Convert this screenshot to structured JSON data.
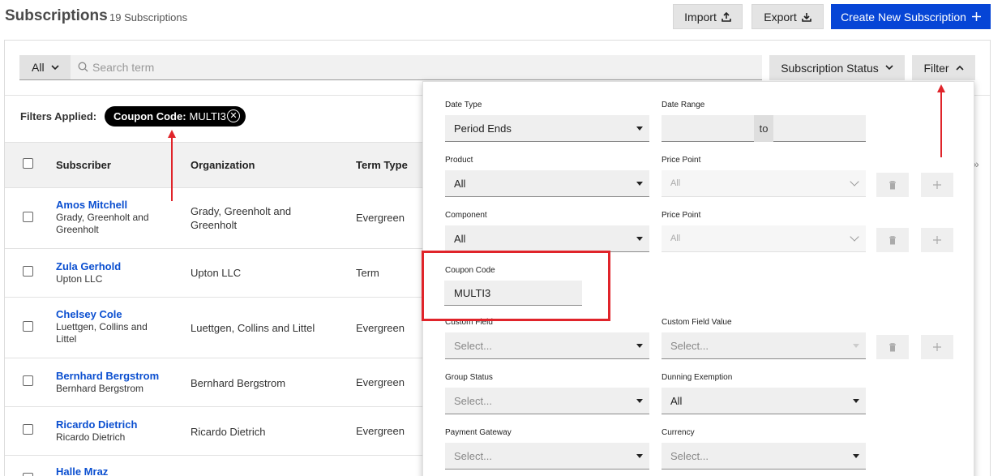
{
  "header": {
    "title": "Subscriptions",
    "count": "19 Subscriptions",
    "import_label": "Import",
    "export_label": "Export",
    "create_label": "Create New Subscription",
    "create_color": "#0645d6"
  },
  "toolbar": {
    "scope_value": "All",
    "search_placeholder": "Search term",
    "status_label": "Subscription Status",
    "filter_label": "Filter"
  },
  "filters_applied": {
    "label": "Filters Applied:",
    "chip_key": "Coupon Code:",
    "chip_value": "MULTI3"
  },
  "table": {
    "columns": [
      "Subscriber",
      "Organization",
      "Term Type"
    ],
    "rows": [
      {
        "name": "Amos Mitchell",
        "subline": "Grady, Greenholt and Greenholt",
        "org": "Grady, Greenholt and Greenholt",
        "term": "Evergreen"
      },
      {
        "name": "Zula Gerhold",
        "subline": "Upton LLC",
        "org": "Upton LLC",
        "term": "Term"
      },
      {
        "name": "Chelsey Cole",
        "subline": "Luettgen, Collins and Littel",
        "org": "Luettgen, Collins and Littel",
        "term": "Evergreen"
      },
      {
        "name": "Bernhard Bergstrom",
        "subline": "Bernhard Bergstrom",
        "org": "Bernhard Bergstrom",
        "term": "Evergreen"
      },
      {
        "name": "Ricardo Dietrich",
        "subline": "Ricardo Dietrich",
        "org": "Ricardo Dietrich",
        "term": "Evergreen"
      },
      {
        "name": "Halle Mraz",
        "subline": "",
        "org": "",
        "term": ""
      }
    ]
  },
  "filter_panel": {
    "date_type": {
      "label": "Date Type",
      "value": "Period Ends"
    },
    "date_range": {
      "label": "Date Range",
      "to": "to"
    },
    "product": {
      "label": "Product",
      "value": "All"
    },
    "price_point_1": {
      "label": "Price Point",
      "value": "All"
    },
    "component": {
      "label": "Component",
      "value": "All"
    },
    "price_point_2": {
      "label": "Price Point",
      "value": "All"
    },
    "coupon_code": {
      "label": "Coupon Code",
      "value": "MULTI3"
    },
    "custom_field": {
      "label": "Custom Field",
      "value": "Select..."
    },
    "custom_field_value": {
      "label": "Custom Field Value",
      "value": "Select..."
    },
    "group_status": {
      "label": "Group Status",
      "value": "Select..."
    },
    "dunning_exemption": {
      "label": "Dunning Exemption",
      "value": "All"
    },
    "payment_gateway": {
      "label": "Payment Gateway",
      "value": "Select..."
    },
    "currency": {
      "label": "Currency",
      "value": "Select..."
    }
  },
  "annotations": {
    "highlight_color": "#e0242a"
  }
}
